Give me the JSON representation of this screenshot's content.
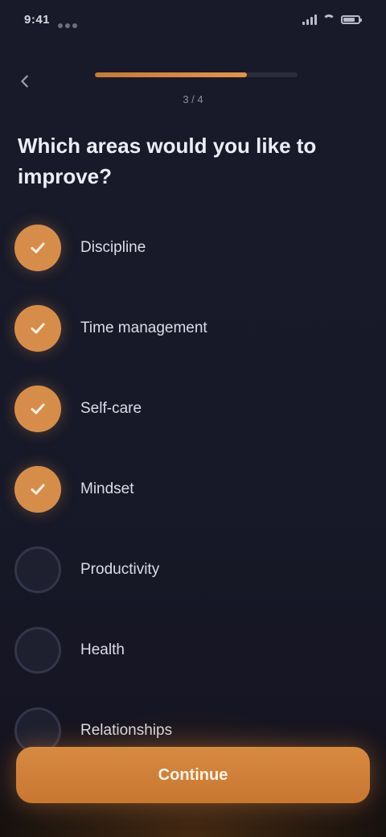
{
  "status_bar": {
    "time": "9:41",
    "battery": "100"
  },
  "header": {
    "progress_fraction": 0.75,
    "progress_label": "3 / 4"
  },
  "question": {
    "text": "Which areas would you like to improve?"
  },
  "options": [
    {
      "label": "Discipline",
      "selected": true
    },
    {
      "label": "Time management",
      "selected": true
    },
    {
      "label": "Self-care",
      "selected": true
    },
    {
      "label": "Mindset",
      "selected": true
    },
    {
      "label": "Productivity",
      "selected": false
    },
    {
      "label": "Health",
      "selected": false
    },
    {
      "label": "Relationships",
      "selected": false
    }
  ],
  "continue_button": {
    "label": "Continue"
  },
  "colors": {
    "accent": "#d78d4a",
    "background": "#171928"
  }
}
